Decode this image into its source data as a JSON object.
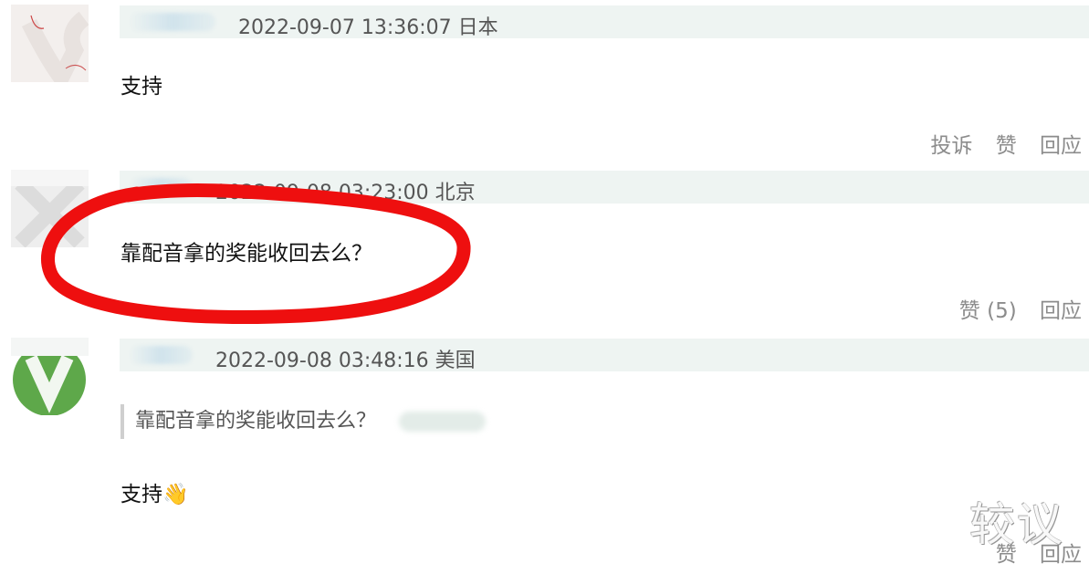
{
  "comments": [
    {
      "timestamp": "2022-09-07 13:36:07",
      "location": "日本",
      "text": "支持",
      "actions": {
        "report": "投诉",
        "like": "赞",
        "reply": "回应"
      }
    },
    {
      "timestamp": "2022-09-08 03:23:00",
      "location": "北京",
      "text": "靠配音拿的奖能收回去么？",
      "actions": {
        "like": "赞 (5)",
        "reply": "回应"
      }
    },
    {
      "timestamp": "2022-09-08 03:48:16",
      "location": "美国",
      "quote": "靠配音拿的奖能收回去么？",
      "text": "支持",
      "emoji": "👋",
      "actions": {
        "like": "赞",
        "reply": "回应"
      }
    }
  ],
  "watermark": "较议",
  "colors": {
    "meta_bar": "#eef4f2",
    "action_text": "#8c8c8c",
    "annotation_circle": "#ee0f0f"
  }
}
